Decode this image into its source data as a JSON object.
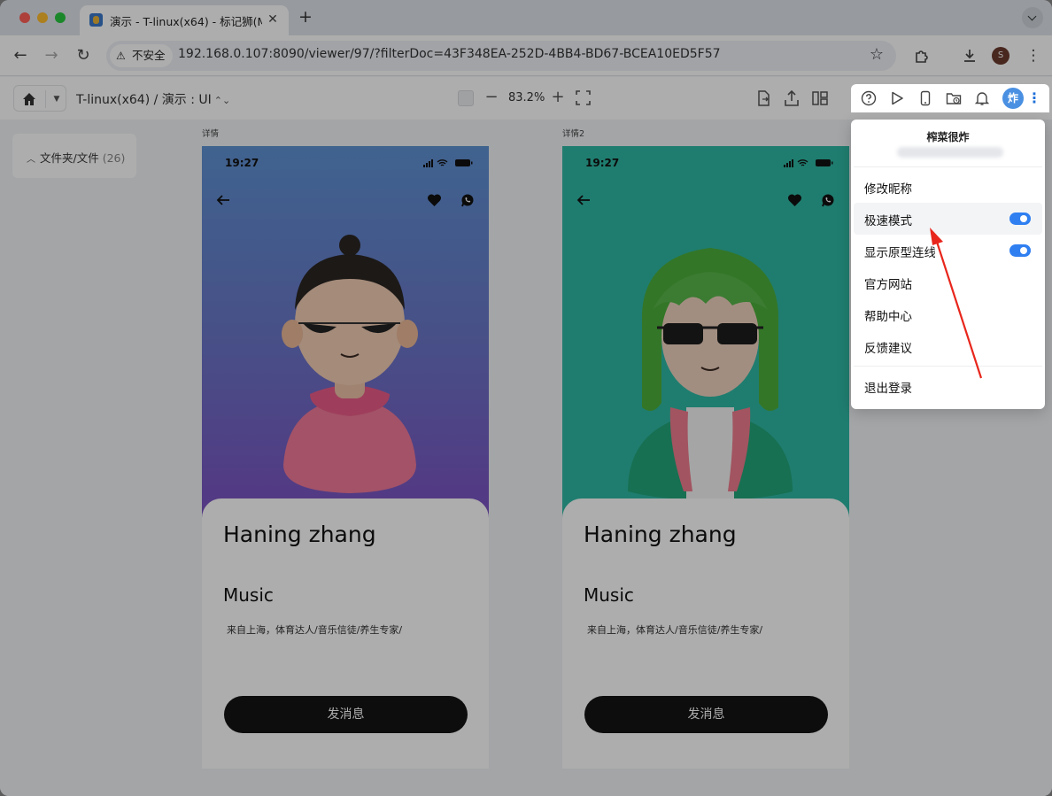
{
  "browser": {
    "tab_title": "演示 - T-linux(x64) - 标记狮(M",
    "close_tab": "✕",
    "new_tab": "+",
    "security_label": "不安全",
    "url": "192.168.0.107:8090/viewer/97/?filterDoc=43F348EA-252D-4BB4-BD67-BCEA10ED5F57",
    "profile_initial": "S"
  },
  "header": {
    "breadcrumb": "T-linux(x64)  /  演示 : UI",
    "zoom": "83.2%"
  },
  "sidebar": {
    "label": "文件夹/文件",
    "count": "(26)"
  },
  "artboards": [
    {
      "label": "详情",
      "time": "19:27",
      "name": "Haning zhang",
      "role": "Music",
      "description": "来自上海，体育达人/音乐信徒/养生专家/",
      "button": "发消息"
    },
    {
      "label": "详情2",
      "time": "19:27",
      "name": "Haning zhang",
      "role": "Music",
      "description": "来自上海，体育达人/音乐信徒/养生专家/",
      "button": "发消息"
    }
  ],
  "user_menu": {
    "avatar_char": "炸",
    "username": "榨菜很炸",
    "items": [
      {
        "label": "修改昵称"
      },
      {
        "label": "极速模式",
        "toggle": true
      },
      {
        "label": "显示原型连线",
        "toggle": true
      },
      {
        "label": "官方网站"
      },
      {
        "label": "帮助中心"
      },
      {
        "label": "反馈建议"
      },
      {
        "label": "退出登录"
      }
    ]
  },
  "colors": {
    "accent": "#2f7ff1",
    "annotation_arrow": "#e8261c",
    "hero1_top": "#5e8fd1",
    "hero1_bottom": "#7b4fc0",
    "hero2": "#2fb8a4"
  }
}
